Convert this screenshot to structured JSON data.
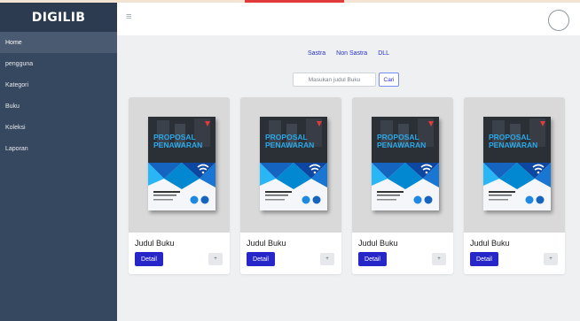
{
  "sidebar": {
    "brand": "DIGILIB",
    "items": [
      {
        "label": "Home"
      },
      {
        "label": "pengguna"
      },
      {
        "label": "Kategori"
      },
      {
        "label": "Buku"
      },
      {
        "label": "Koleksi"
      },
      {
        "label": "Laporan"
      }
    ]
  },
  "topbar": {
    "menu_icon": "hamburger-icon",
    "menu_glyph": "≡",
    "user_icon": "user-avatar-icon"
  },
  "categories": [
    "Sastra",
    "Non Sastra",
    "DLL"
  ],
  "search": {
    "placeholder": "Masukan judul Buku",
    "button": "Cari"
  },
  "cards": [
    {
      "title": "Judul Buku",
      "detail": "Detail",
      "plus": "+"
    },
    {
      "title": "Judul Buku",
      "detail": "Detail",
      "plus": "+"
    },
    {
      "title": "Judul Buku",
      "detail": "Detail",
      "plus": "+"
    },
    {
      "title": "Judul Buku",
      "detail": "Detail",
      "plus": "+"
    }
  ],
  "cover": {
    "line1": "PROPOSAL",
    "line2": "PENAWARAN",
    "sub": "LAYANAN JARINGAN INTERNET DEDICATED"
  },
  "colors": {
    "sidebar": "#36485f",
    "brand_bg": "#2c3b4f",
    "active_item": "#4a5a70",
    "accent": "#2626c9"
  }
}
